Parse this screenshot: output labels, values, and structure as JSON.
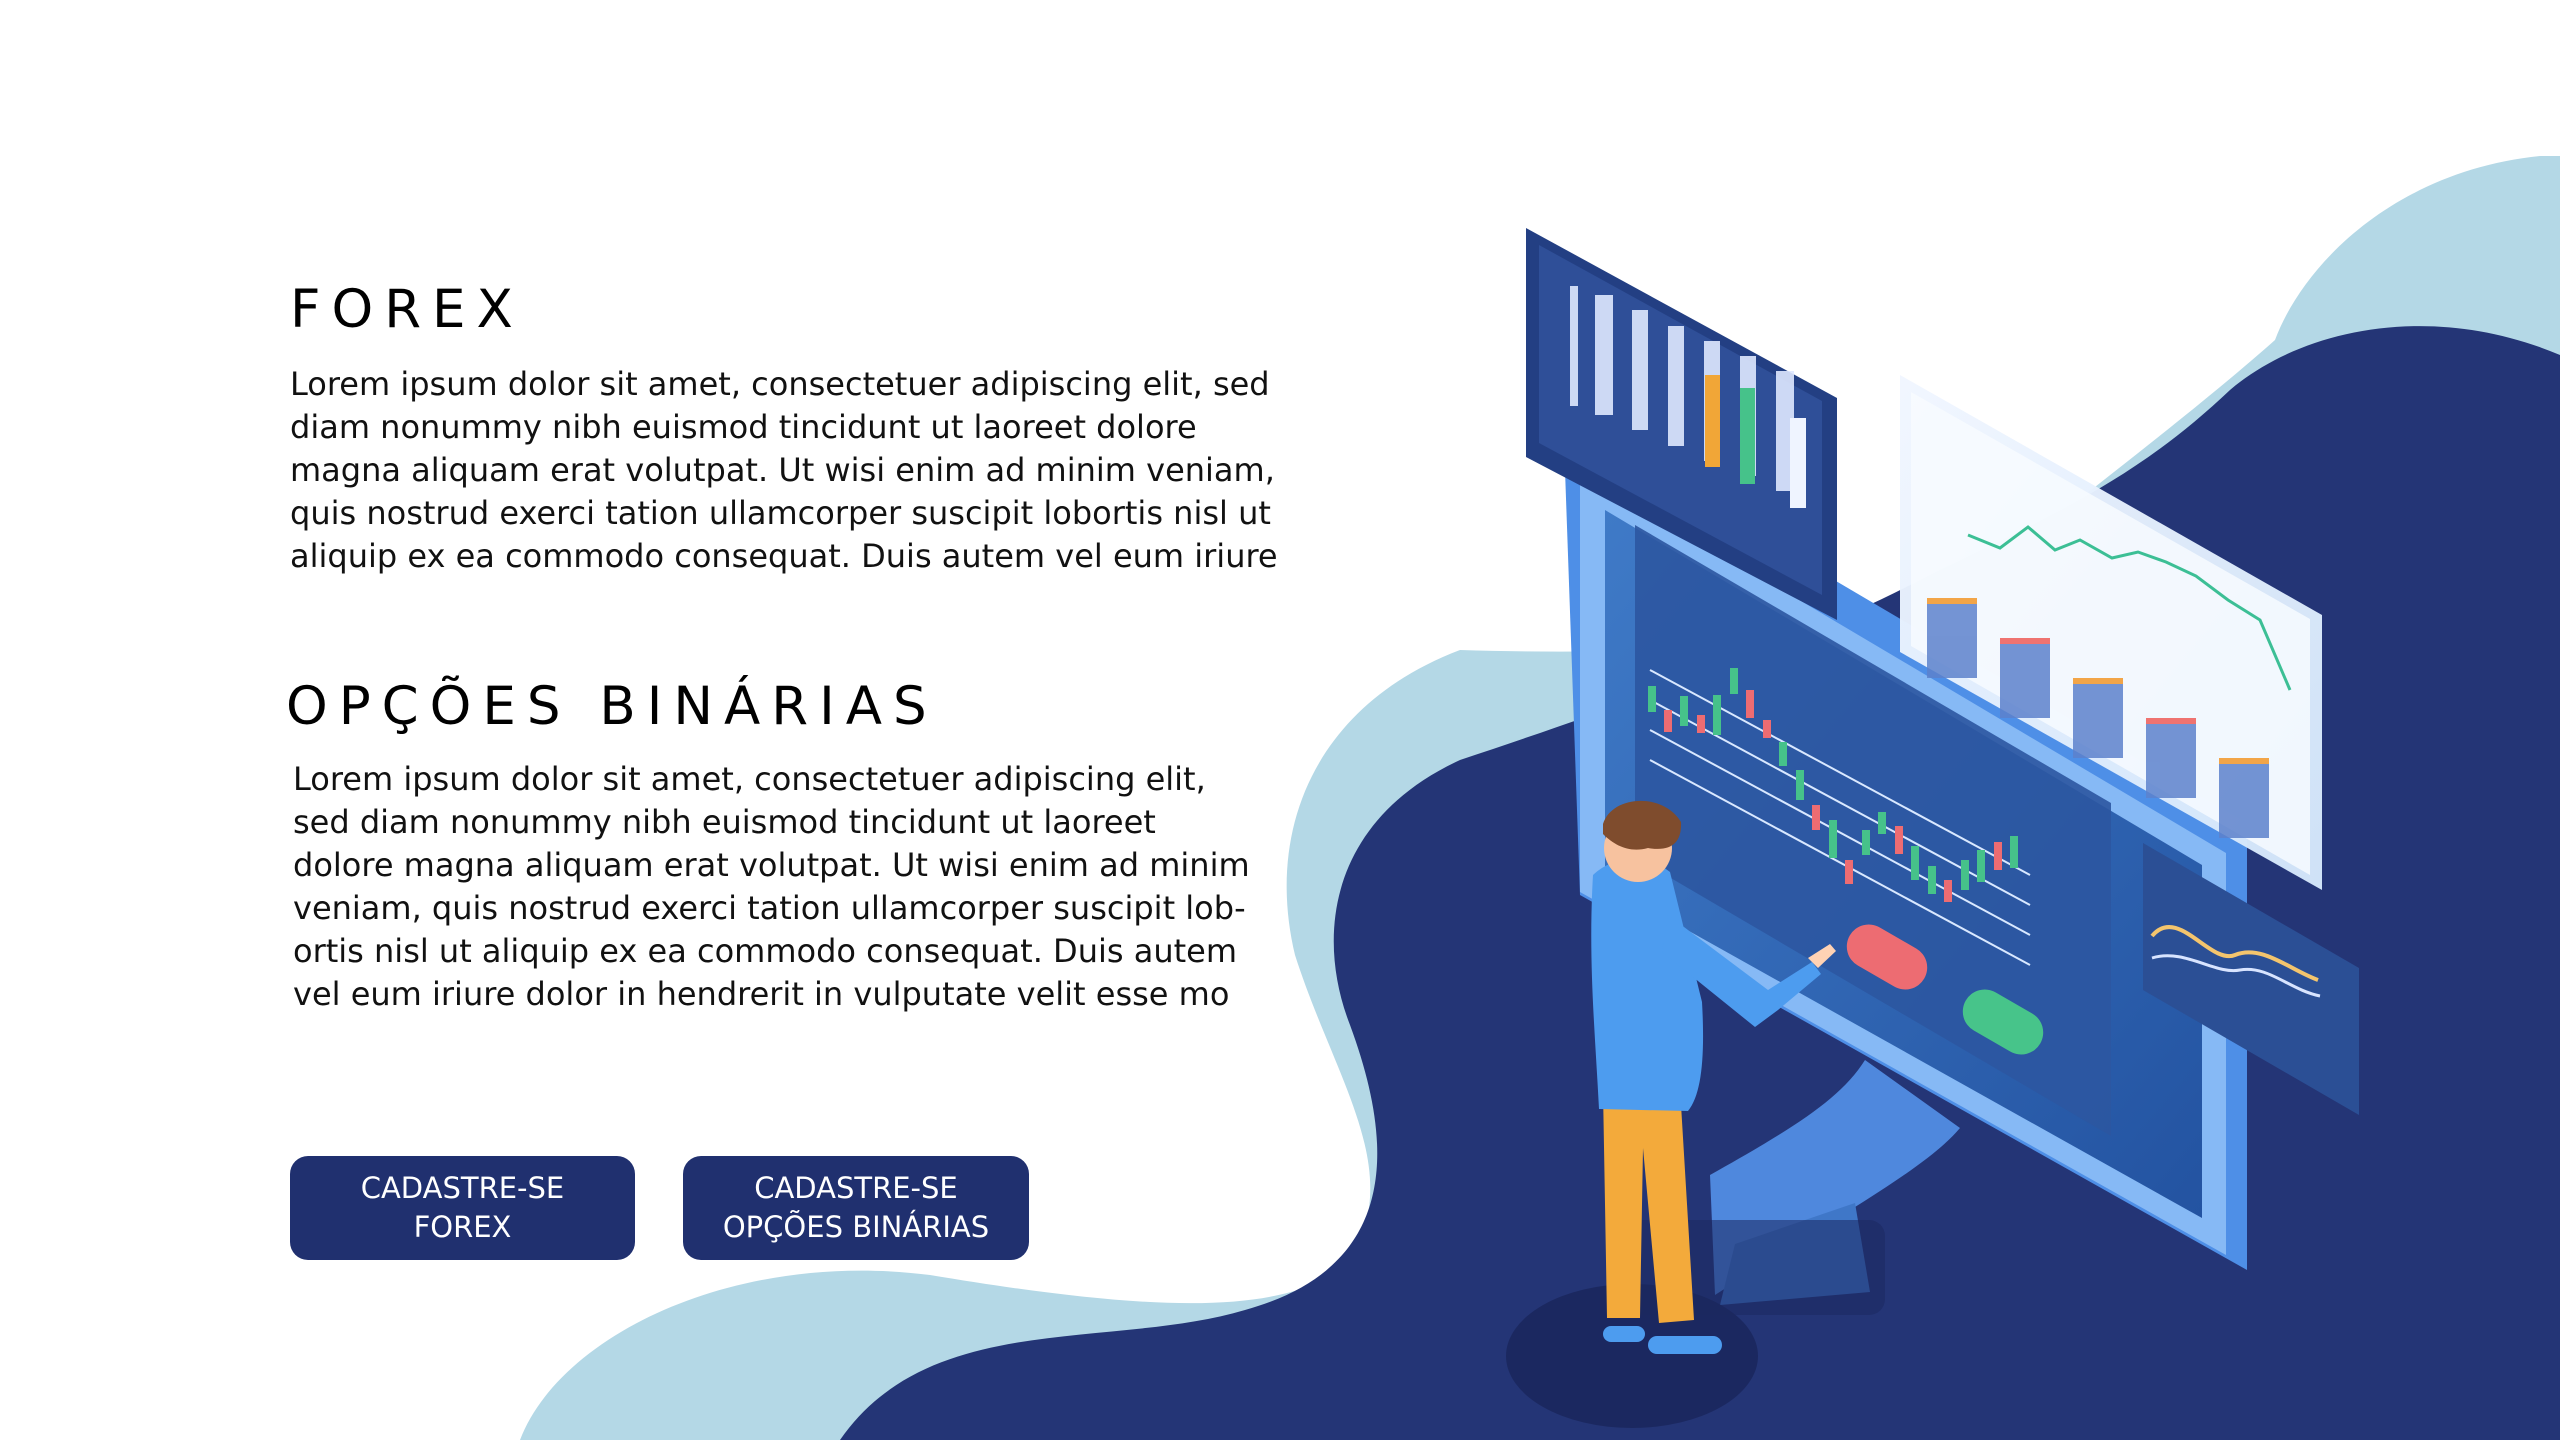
{
  "sections": [
    {
      "title": "FOREX",
      "lines": [
        "Lorem ipsum dolor sit amet, consectetuer adipiscing elit, sed",
        "diam nonummy nibh euismod tincidunt ut laoreet dolore",
        "magna aliquam erat volutpat. Ut wisi enim ad minim veniam,",
        "quis nostrud exerci tation ullamcorper suscipit lobortis nisl ut",
        "aliquip ex ea commodo consequat. Duis autem vel eum iriure"
      ]
    },
    {
      "title": "OPÇÕES BINÁRIAS",
      "lines": [
        "Lorem ipsum dolor sit amet, consectetuer adipiscing elit,",
        "sed diam nonummy nibh euismod tincidunt ut laoreet",
        "dolore magna aliquam erat volutpat. Ut wisi enim ad minim",
        "veniam, quis nostrud exerci tation ullamcorper suscipit lob-",
        "ortis nisl ut aliquip ex ea commodo consequat. Duis autem",
        "vel eum iriure dolor in hendrerit in vulputate velit esse mo"
      ]
    }
  ],
  "buttons": [
    {
      "lines": [
        "CADASTRE-SE",
        "FOREX"
      ]
    },
    {
      "lines": [
        "CADASTRE-SE",
        "OPÇÕES BINÁRIAS"
      ]
    }
  ],
  "colors": {
    "background": "#ffffff",
    "navy": "#20306f",
    "light_blue": "#b4d8e6",
    "screen_blue": "#2a5ca8",
    "accent_blue": "#4c9be9",
    "green": "#47c48a",
    "red": "#ed6c72",
    "orange": "#f4a937"
  },
  "illustration": {
    "icons": [
      "trader-figure-icon",
      "desktop-monitor-icon",
      "candlestick-chart-icon",
      "line-chart-icon",
      "data-table-icon",
      "wave-chart-icon"
    ]
  }
}
